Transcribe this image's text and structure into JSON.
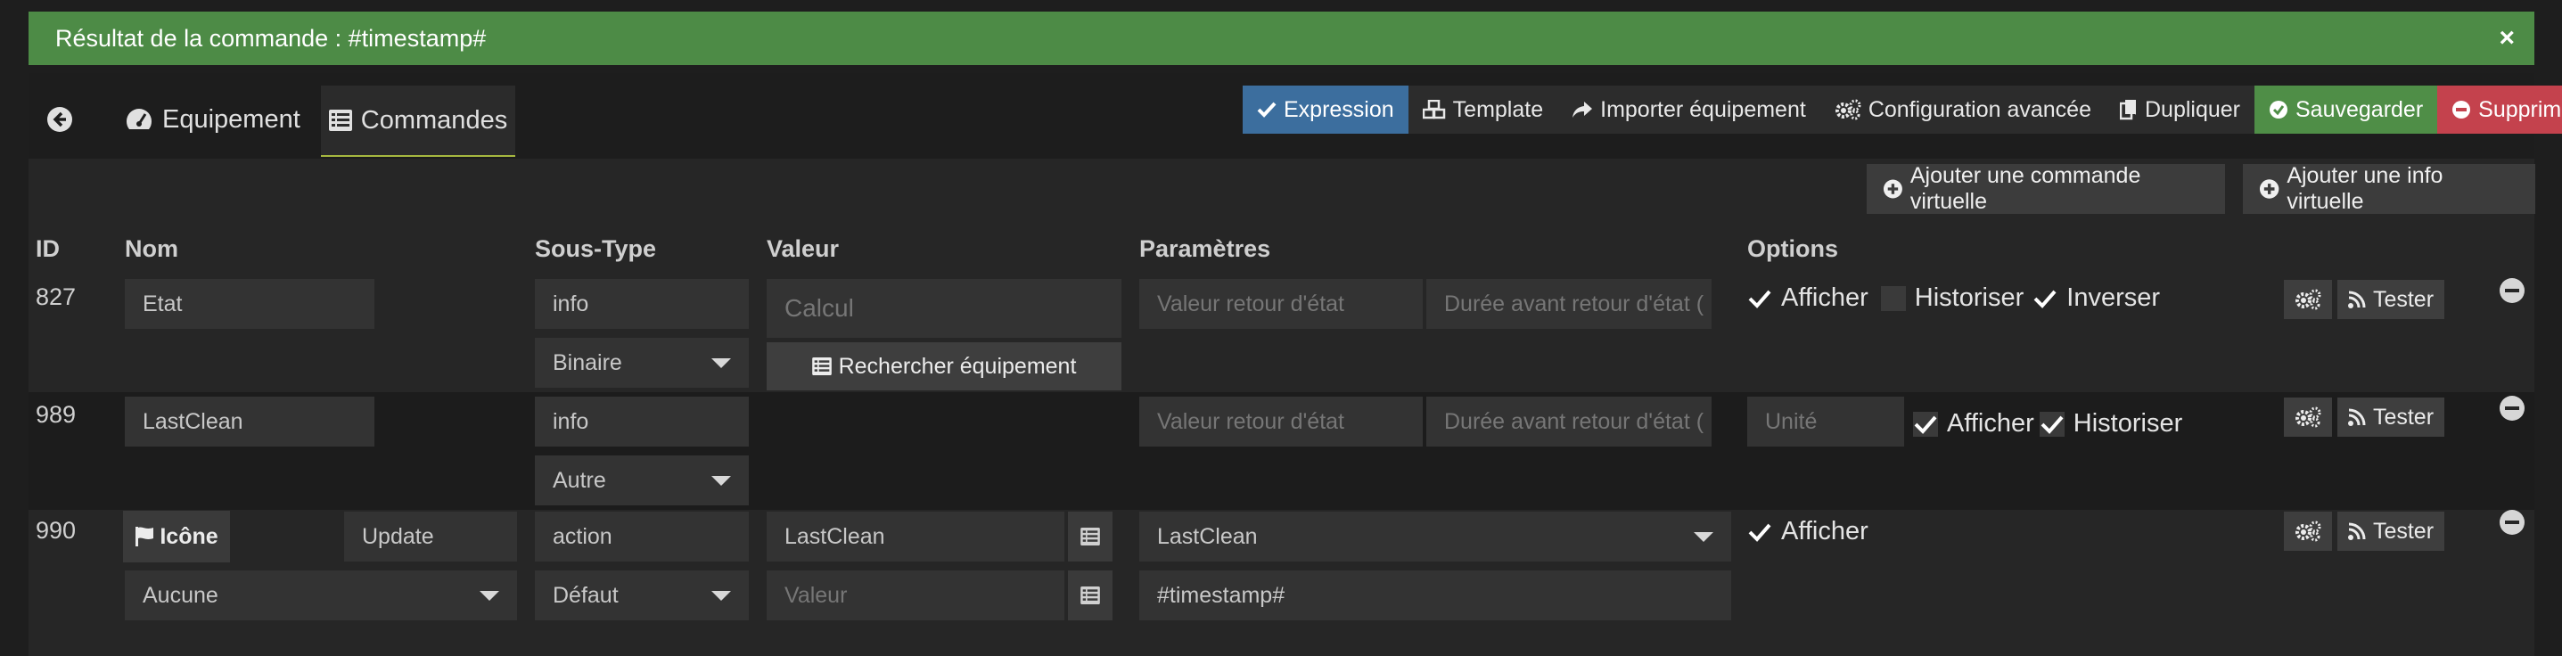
{
  "alert": {
    "message": "Résultat de la commande : #timestamp#",
    "close": "×"
  },
  "tabs": {
    "equipment": "Equipement",
    "commands": "Commandes"
  },
  "toolbar": {
    "expression": "Expression",
    "template": "Template",
    "import": "Importer équipement",
    "advanced": "Configuration avancée",
    "duplicate": "Dupliquer",
    "save": "Sauvegarder",
    "delete": "Supprimer"
  },
  "add_buttons": {
    "virtual_command": "Ajouter une commande virtuelle",
    "virtual_info": "Ajouter une info virtuelle"
  },
  "headers": {
    "id": "ID",
    "name": "Nom",
    "subtype": "Sous-Type",
    "value": "Valeur",
    "params": "Paramètres",
    "options": "Options"
  },
  "rows": [
    {
      "id": "827",
      "name": "Etat",
      "type": "info",
      "subtype": "Binaire",
      "value_placeholder": "Calcul",
      "search_label": "Rechercher équipement",
      "param1_placeholder": "Valeur retour d'état",
      "param2_placeholder": "Durée avant retour d'état (",
      "opt_display": "Afficher",
      "opt_history": "Historiser",
      "opt_invert": "Inverser",
      "test_label": "Tester"
    },
    {
      "id": "989",
      "name": "LastClean",
      "type": "info",
      "subtype": "Autre",
      "param1_placeholder": "Valeur retour d'état",
      "param2_placeholder": "Durée avant retour d'état (",
      "unit_placeholder": "Unité",
      "opt_display": "Afficher",
      "opt_history": "Historiser",
      "test_label": "Tester"
    },
    {
      "id": "990",
      "icon_label": "Icône",
      "name": "Update",
      "icon_value": "Aucune",
      "type": "action",
      "subtype": "Défaut",
      "value": "LastClean",
      "value2_placeholder": "Valeur",
      "param_select": "LastClean",
      "param_value": "#timestamp#",
      "opt_display": "Afficher",
      "test_label": "Tester"
    }
  ],
  "colors": {
    "success": "#4d8b46",
    "primary": "#3c6e9e",
    "save": "#4f8e47",
    "danger": "#c4424d",
    "tab_accent": "#a7b840"
  }
}
